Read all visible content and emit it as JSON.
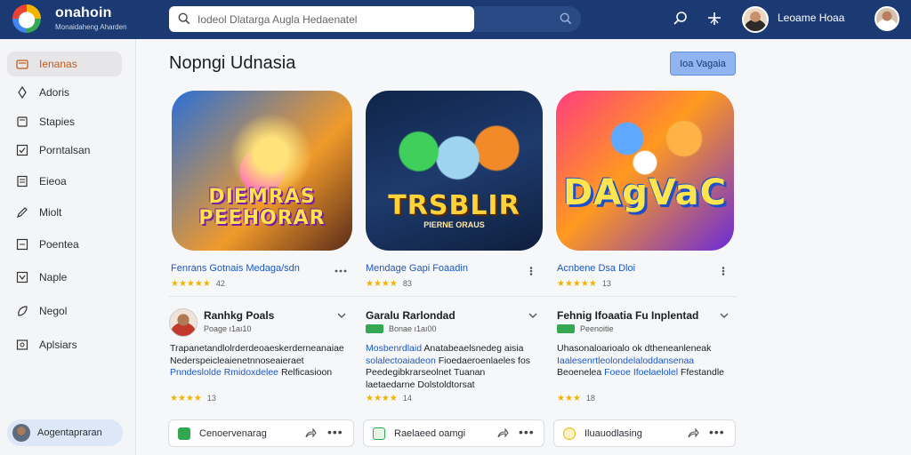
{
  "app": {
    "brand": "onahoin",
    "brand_sub": "Monaidaheng Aharden",
    "search_placeholder": "Iodeol Dlatarga Augla Hedaenatel",
    "user_name": "Leoame Hoaa"
  },
  "sidebar": {
    "items": [
      {
        "label": "Ienanas",
        "icon": "home-icon"
      },
      {
        "label": "Adoris",
        "icon": "pin-icon"
      },
      {
        "label": "Stapies",
        "icon": "book-icon"
      },
      {
        "label": "Porntalsan",
        "icon": "check-square-icon"
      },
      {
        "label": "Eieoa",
        "icon": "document-icon"
      },
      {
        "label": "Miolt",
        "icon": "pen-icon"
      },
      {
        "label": "Poentea",
        "icon": "list-icon"
      },
      {
        "label": "Naple",
        "icon": "checkbox-icon"
      },
      {
        "label": "Negol",
        "icon": "leaf-icon"
      },
      {
        "label": "Aplsiars",
        "icon": "settings-icon"
      }
    ],
    "footer_label": "Aogentapraran"
  },
  "main": {
    "title": "Nopngi Udnasia",
    "top_button": "Ioa Vagaia"
  },
  "games": [
    {
      "title": "Fenrans Gotnais Medaga/sdn",
      "art_text": "DIEMRAS PEEHORAR",
      "stars": "★★★★★",
      "count": "42",
      "reviewer": "Ranhkg Poals",
      "reviewer_meta": "Poage ı1aı10",
      "review_plain_1": "Trapanetandlolrderdeoaeskerderneanaiae Nederspeicleaienetnnoseaieraet",
      "review_link_1": "Pnndeslolde",
      "review_link_2": "Rmidoxdelee",
      "review_plain_2": "Relficasioon",
      "review_stars": "★★★★",
      "review_count": "13",
      "action_label": "Cenoervenarag"
    },
    {
      "title": "Mendage Gapi Foaadin",
      "art_text": "TRSBLIR",
      "art_sub": "PIERNE ORAUS",
      "stars": "★★★★",
      "count": "83",
      "reviewer": "Garalu Rarlondad",
      "reviewer_meta": "Bonae ı1aı00",
      "review_link_1": "Mosbenrdlaid",
      "review_plain_1": "Anatabeaelsnedeg aisia",
      "review_link_2": "solalectoaiadeon",
      "review_plain_2": "Fioedaeroenlaeles fos Peedegibkrarseolnet Tuanan laetaedarne",
      "review_plain_3": "Dolstoldtorsat",
      "review_stars": "★★★★",
      "review_count": "14",
      "action_label": "Raelaeed oamgi"
    },
    {
      "title": "Acnbene Dsa Dloi",
      "art_text": "DAgVaC",
      "stars": "★★★★★",
      "count": "13",
      "reviewer": "Fehnig Ifoaatia Fu Inplentad",
      "reviewer_meta": "Peenoitie",
      "review_plain_1": "Uhasonaloarioalo ok dtheneanleneak",
      "review_link_1": "Iaalesenrtleolondelaloddansenaa",
      "review_plain_2": "Beoenelea",
      "review_link_2": "Foeoe Ifoelaelolel",
      "review_plain_3": "Ffestandle",
      "review_stars": "★★★",
      "review_count": "18",
      "action_label": "Iluauodlasing"
    }
  ],
  "colors": {
    "topbar": "#1b3a73",
    "accent_orange": "#c45a18",
    "link_blue": "#1a57c4",
    "star": "#f0b400"
  }
}
